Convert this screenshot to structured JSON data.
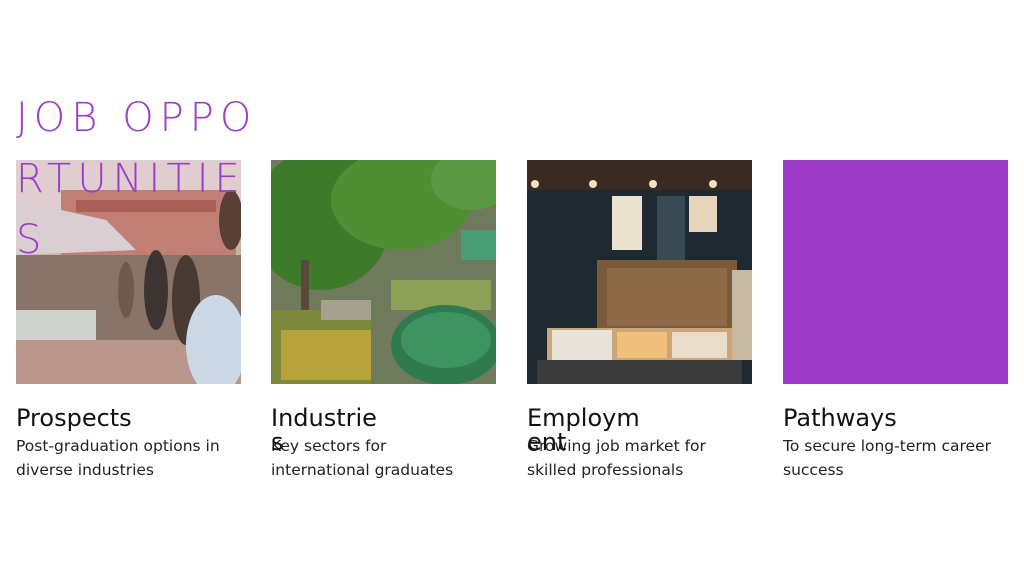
{
  "section": {
    "title": "JOB OPPORTUNITIES"
  },
  "cards": [
    {
      "heading": "Prospects",
      "description": "Post-graduation options in diverse industries",
      "image": "outdoor-market-photo"
    },
    {
      "heading": "Industries",
      "description": "Key sectors for international graduates",
      "image": "market-green-umbrella-photo"
    },
    {
      "heading": "Employment",
      "description": "Growing job market for skilled professionals",
      "image": "japanese-food-stall-photo"
    },
    {
      "heading": "Pathways",
      "description": "To secure long-term career success",
      "image": "purple-block",
      "color": "#9b3bc7"
    }
  ],
  "colors": {
    "accent": "#9b3fc6"
  }
}
